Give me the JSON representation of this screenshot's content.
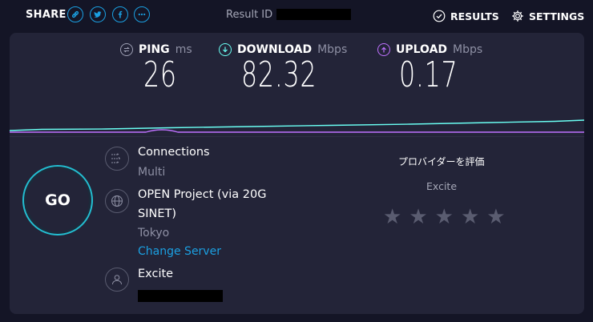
{
  "topbar": {
    "share_label": "SHARE",
    "share_buttons": [
      "link-icon",
      "twitter-icon",
      "facebook-icon",
      "more-icon"
    ],
    "result_id_label": "Result ID",
    "results_label": "RESULTS",
    "settings_label": "SETTINGS"
  },
  "metrics": {
    "ping": {
      "label": "PING",
      "unit": "ms",
      "value": "26",
      "color": "#9ea0b4"
    },
    "download": {
      "label": "DOWNLOAD",
      "unit": "Mbps",
      "value": "82.32",
      "color": "#6afff3"
    },
    "upload": {
      "label": "UPLOAD",
      "unit": "Mbps",
      "value": "0.17",
      "color": "#bf71ff"
    }
  },
  "go_label": "GO",
  "connections": {
    "title": "Connections",
    "value": "Multi"
  },
  "server": {
    "title_line1": "OPEN Project (via 20G",
    "title_line2": "SINET)",
    "location": "Tokyo",
    "change_label": "Change Server"
  },
  "user": {
    "isp": "Excite"
  },
  "rating": {
    "title": "プロバイダーを評価",
    "isp": "Excite",
    "stars": 5
  },
  "colors": {
    "accent": "#1ba0e2",
    "go_ring": "#23bdd0",
    "background": "#141526",
    "panel": "#232438"
  }
}
